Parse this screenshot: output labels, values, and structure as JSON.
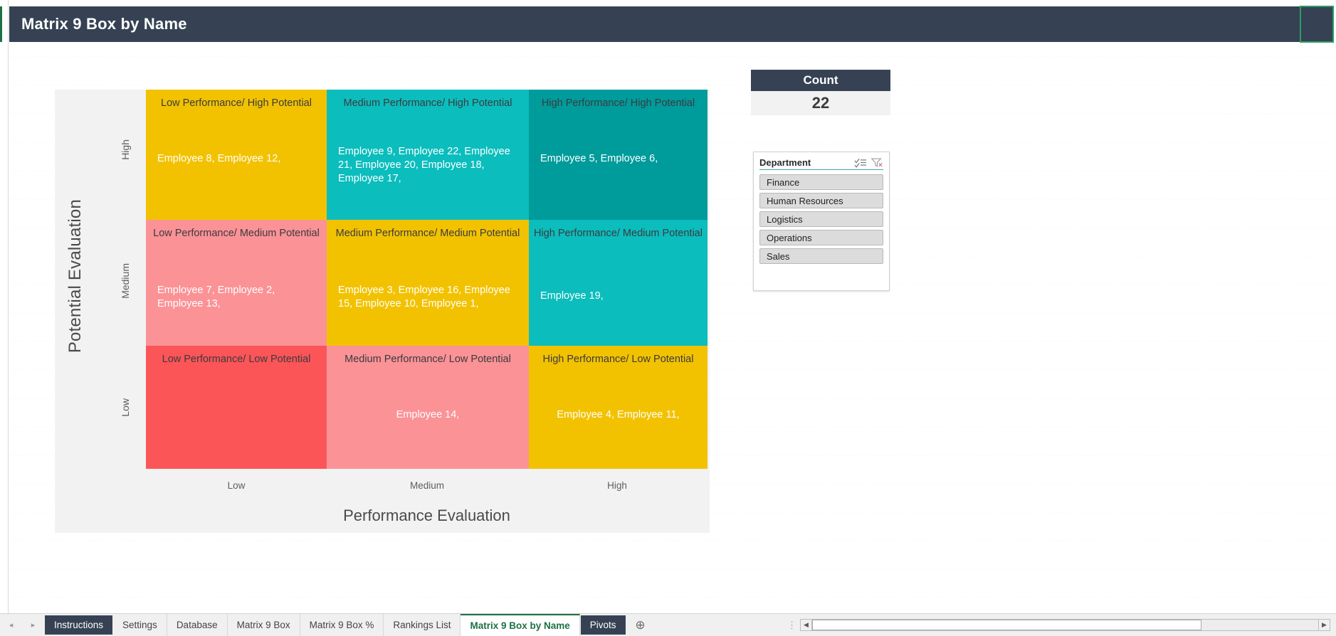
{
  "window": {
    "banner_title": "Matrix 9 Box by Name",
    "banner_color": "#364254",
    "selected_cell_border": "#2e9b63"
  },
  "chart_data": {
    "type": "heatmap",
    "title": "Matrix 9 Box by Name",
    "xlabel": "Performance Evaluation",
    "ylabel": "Potential Evaluation",
    "x_categories": [
      "Low",
      "Medium",
      "High"
    ],
    "y_categories": [
      "High",
      "Medium",
      "Low"
    ],
    "grid": false,
    "legend": "none",
    "plot_background": "#f2f2f2",
    "cells": [
      {
        "row": "High",
        "col": "Low",
        "title": "Low Performance/ High Potential",
        "names": "Employee 8, Employee 12,",
        "count": 2,
        "color": "#f2c200"
      },
      {
        "row": "High",
        "col": "Medium",
        "title": "Medium Performance/ High Potential",
        "names": "Employee 9, Employee 22, Employee 21, Employee 20, Employee 18, Employee 17,",
        "count": 6,
        "color": "#0bbdbd"
      },
      {
        "row": "High",
        "col": "High",
        "title": "High Performance/ High Potential",
        "names": "Employee 5, Employee 6,",
        "count": 2,
        "color": "#009b9b"
      },
      {
        "row": "Medium",
        "col": "Low",
        "title": "Low Performance/ Medium Potential",
        "names": "Employee 7, Employee 2, Employee 13,",
        "count": 3,
        "color": "#fb9296"
      },
      {
        "row": "Medium",
        "col": "Medium",
        "title": "Medium Performance/ Medium Potential",
        "names": "Employee 3, Employee 16, Employee 15, Employee 10, Employee 1,",
        "count": 5,
        "color": "#f2c200"
      },
      {
        "row": "Medium",
        "col": "High",
        "title": "High Performance/ Medium Potential",
        "names": "Employee 19,",
        "count": 1,
        "color": "#0bbdbd"
      },
      {
        "row": "Low",
        "col": "Low",
        "title": "Low Performance/ Low Potential",
        "names": "",
        "count": 0,
        "color": "#fb5558"
      },
      {
        "row": "Low",
        "col": "Medium",
        "title": "Medium Performance/ Low Potential",
        "names": "Employee 14,",
        "count": 1,
        "color": "#fb9296"
      },
      {
        "row": "Low",
        "col": "High",
        "title": "High Performance/ Low Potential",
        "names": "Employee 4, Employee 11,",
        "count": 2,
        "color": "#f2c200"
      }
    ]
  },
  "count_card": {
    "header": "Count",
    "value": "22"
  },
  "slicer": {
    "title": "Department",
    "multiselect_icon": "multi-select-icon",
    "clear_filter_icon": "clear-filter-icon",
    "items": [
      {
        "label": "Finance"
      },
      {
        "label": "Human Resources"
      },
      {
        "label": "Logistics"
      },
      {
        "label": "Operations"
      },
      {
        "label": "Sales"
      }
    ]
  },
  "sheet_tabs": {
    "tabs": [
      {
        "label": "Instructions",
        "style": "dark"
      },
      {
        "label": "Settings",
        "style": "normal"
      },
      {
        "label": "Database",
        "style": "normal"
      },
      {
        "label": "Matrix 9 Box",
        "style": "normal"
      },
      {
        "label": "Matrix 9 Box %",
        "style": "normal"
      },
      {
        "label": "Rankings List",
        "style": "normal"
      },
      {
        "label": "Matrix 9 Box by Name",
        "style": "active"
      },
      {
        "label": "Pivots",
        "style": "dark"
      }
    ],
    "add_sheet_label": "⊕",
    "nav_prev": "◂",
    "nav_next": "▸",
    "scroll_left": "◀",
    "scroll_right": "▶",
    "dots": "⋮"
  }
}
